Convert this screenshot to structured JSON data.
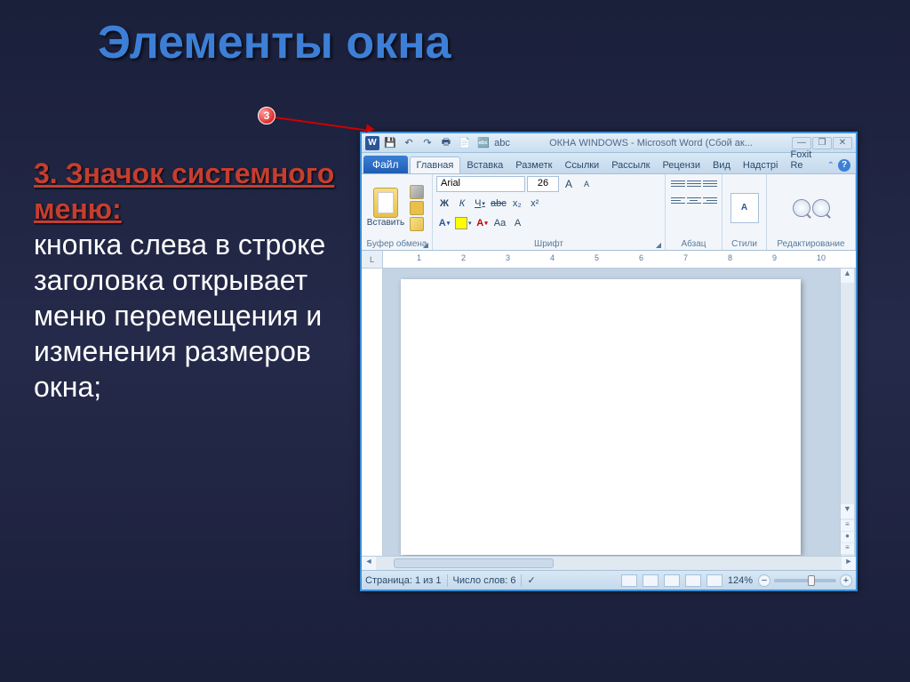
{
  "slide": {
    "title": "Элементы окна",
    "callout_number": "3",
    "heading": "3. Значок системного меню:",
    "body": "кнопка слева в строке заголовка открывает меню перемещения и изменения размеров окна;"
  },
  "word": {
    "sys_icon_letter": "W",
    "title": "ОКНА WINDOWS  -  Microsoft Word (Сбой ак...",
    "qat": [
      "💾",
      "↶",
      "↷",
      "🖶",
      "📄",
      "🔤",
      "abc"
    ],
    "win_controls": {
      "min": "—",
      "max": "❐",
      "close": "✕"
    },
    "file_tab": "Файл",
    "tabs": [
      "Главная",
      "Вставка",
      "Разметк",
      "Ссылки",
      "Рассылк",
      "Рецензи",
      "Вид",
      "Надстрі",
      "Foxit Re"
    ],
    "help_icon": "?",
    "ribbon": {
      "clipboard": {
        "label": "Буфер обмена",
        "paste": "Вставить"
      },
      "font": {
        "label": "Шрифт",
        "name": "Arial",
        "size": "26",
        "bold": "Ж",
        "italic": "К",
        "underline": "Ч",
        "strike": "abc",
        "sub": "x₂",
        "sup": "x²",
        "grow": "A",
        "shrink": "A",
        "case": "Aa",
        "clear": "A"
      },
      "paragraph": {
        "label": "Абзац"
      },
      "styles": {
        "label": "Стили",
        "icon": "A"
      },
      "editing": {
        "label": "Редактирование"
      }
    },
    "ruler_numbers": [
      "1",
      "2",
      "3",
      "4",
      "5",
      "6",
      "7",
      "8",
      "9",
      "10"
    ],
    "status": {
      "page": "Страница: 1 из 1",
      "words": "Число слов: 6",
      "lang_icon": "✓",
      "zoom": "124%",
      "minus": "−",
      "plus": "+"
    }
  }
}
